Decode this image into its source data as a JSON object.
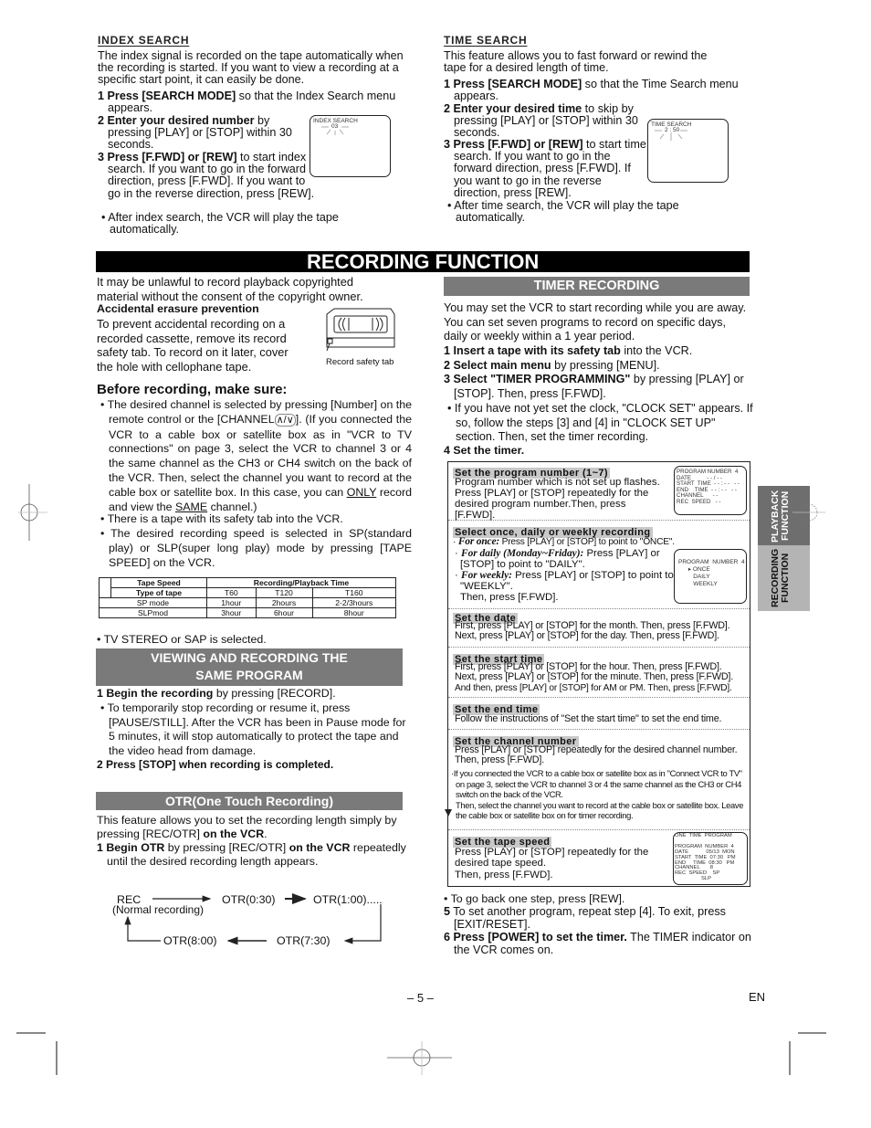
{
  "index_search": {
    "heading": "INDEX SEARCH",
    "intro": "The index signal is recorded on the tape automatically when the recording is started. If you want to view a recording at a specific start point, it can easily be done.",
    "steps": [
      {
        "num": "1",
        "bold": "Press [SEARCH MODE]",
        "text": " so that the Index Search menu appears."
      },
      {
        "num": "2",
        "bold": "Enter your desired number",
        "text": " by pressing [PLAY] or [STOP] within 30 seconds."
      },
      {
        "num": "3",
        "bold": "Press [F.FWD] or [REW]",
        "text": " to start index search. If you want to go in the forward direction, press [F.FWD]. If you want to go in the reverse direction, press [REW]."
      }
    ],
    "note": "After index search, the VCR will play the tape automatically.",
    "screen": {
      "title": "INDEX SEARCH",
      "value": "03"
    }
  },
  "time_search": {
    "heading": "TIME SEARCH",
    "intro": "This feature allows you to fast forward or rewind the tape for a desired length of time.",
    "steps": [
      {
        "num": "1",
        "bold": "Press  [SEARCH MODE]",
        "text": " so that the Time Search menu appears."
      },
      {
        "num": "2",
        "bold": "Enter your desired time",
        "text": " to skip by pressing [PLAY] or [STOP] within 30 seconds."
      },
      {
        "num": "3",
        "bold": "Press [F.FWD] or [REW]",
        "text": " to start time search. If you want to go in the forward direction, press [F.FWD]. If you want to go in the reverse direction, press [REW]."
      }
    ],
    "note": "After time search, the VCR will play the tape automatically.",
    "screen": {
      "title": "TIME SEARCH",
      "value": "2 : 50"
    }
  },
  "main_title": "RECORDING FUNCTION",
  "left": {
    "copyright": "It may be unlawful to record playback copyrighted material without the consent of the copyright owner.",
    "erasure_heading": "Accidental erasure prevention",
    "erasure_text": "To prevent accidental recording on a recorded cassette, remove its record safety tab. To record on it later, cover the hole with cellophane tape.",
    "cassette_caption": "Record safety tab",
    "before_heading": "Before recording, make sure:",
    "before_bullets": {
      "b1_a": "The desired channel is selected by pressing [Number] on the remote control or the [CHANNEL",
      "b1_sym": "∧/∨",
      "b1_b": "]. (If you connected the VCR to a cable box or satellite box as in \"VCR to TV connections\" on page 3, select the VCR to channel 3 or 4 the same channel as the CH3 or CH4 switch on the back of the VCR. Then, select the channel you want to record at the cable box or satellite box. In this case, you can ",
      "b1_u1": "ONLY",
      "b1_c": " record and view the ",
      "b1_u2": "SAME",
      "b1_d": " channel.)",
      "b2": "There is a tape with its safety tab into the VCR.",
      "b3": "The desired recording speed is selected in SP(standard play) or SLP(super long play) mode by pressing [TAPE SPEED] on the VCR."
    },
    "tape_table": {
      "h_speed": "Tape Speed",
      "h_time": "Recording/Playback Time",
      "h_type": "Type of tape",
      "cols": [
        "T60",
        "T120",
        "T160"
      ],
      "rows": [
        {
          "mode": "SP mode",
          "values": [
            "1hour",
            "2hours",
            "2-2/3hours"
          ]
        },
        {
          "mode": "SLPmod",
          "values": [
            "3hour",
            "6hour",
            "8hour"
          ]
        }
      ]
    },
    "stereo_note": "TV STEREO or SAP is selected.",
    "viewing": {
      "title_l1": "VIEWING AND RECORDING THE",
      "title_l2": "SAME PROGRAM",
      "step1_bold": "1 Begin the recording",
      "step1_text": " by pressing [RECORD].",
      "bullet": "To temporarily stop recording or resume it, press [PAUSE/STILL]. After the VCR has been in Pause mode for 5 minutes, it will stop automatically to protect the tape and the video head from damage.",
      "step2_bold": "2 Press [STOP] when recording is completed."
    },
    "otr": {
      "title": "OTR(One Touch Recording)",
      "intro_a": "This feature allows you to set the recording length simply by pressing [REC/OTR] ",
      "intro_b": "on the VCR",
      "intro_c": ".",
      "step1_bold": "1 Begin OTR",
      "step1_text": " by pressing [REC/OTR] ",
      "step1_bold2": "on the VCR",
      "step1_text2": " repeatedly until the desired recording length appears.",
      "diagram": {
        "rec": "REC",
        "rec_sub": "(Normal recording)",
        "n1": "OTR(0:30)",
        "n2": "OTR(1:00).....",
        "n3": "OTR(7:30)",
        "n4": "OTR(8:00)"
      }
    }
  },
  "timer": {
    "title": "TIMER RECORDING",
    "intro": "You may set the VCR to start recording while you are away. You can set seven programs to record on specific days, daily or weekly within a 1 year period.",
    "steps": [
      {
        "bold": "1 Insert a tape with its safety tab",
        "text": " into the VCR."
      },
      {
        "bold": "2 Select main menu",
        "text": " by pressing [MENU]."
      },
      {
        "bold": "3 Select \"TIMER PROGRAMMING\"",
        "text": " by pressing [PLAY] or [STOP]. Then, press [F.FWD]."
      }
    ],
    "clock_note": "If you have not yet set the clock, \"CLOCK SET\" appears. If so, follow the steps [3] and [4] in \"CLOCK SET UP\" section. Then, set the timer recording.",
    "step4": "4 Set the timer.",
    "sections": {
      "program": {
        "title": "Set the program number (1~7)",
        "text": "Program number which is not set up flashes. Press [PLAY] or [STOP] repeatedly for the desired program number.Then, press [F.FWD].",
        "screen": "PROGRAM NUMBER  4\nDATE          - - / - -\nSTART  TIME  - - : - -   - -\nEND    TIME  - - : - -   - -\nCHANNEL      - -\nREC  SPEED   - -"
      },
      "once": {
        "title": "Select once, daily or weekly recording",
        "once_label": "For once:",
        "once_text": " Press [PLAY] or [STOP] to point to \"ONCE\".",
        "daily_label": "For daily (Monday~Friday):",
        "daily_text": " Press [PLAY] or [STOP] to point to \"DAILY\".",
        "weekly_label": "For weekly:",
        "weekly_text": " Press [PLAY] or [STOP] to point to \"WEEKLY\".",
        "then": "Then, press [F.FWD].",
        "screen": "PROGRAM  NUMBER  4\n      ▸ ONCE\n         DAILY\n         WEEKLY"
      },
      "date": {
        "title": "Set the date",
        "text": "First, press [PLAY] or [STOP] for the month. Then, press [F.FWD]. Next, press [PLAY] or [STOP] for the day. Then, press [F.FWD]."
      },
      "start": {
        "title": "Set the start time",
        "l1": "First, press [PLAY] or [STOP] for the hour. Then, press [F.FWD].",
        "l2": "Next, press [PLAY] or [STOP] for the minute. Then, press [F.FWD].",
        "l3": "And then, press [PLAY] or [STOP] for AM or PM. Then, press [F.FWD]."
      },
      "end": {
        "title": "Set the end time",
        "text": "Follow the instructions of \"Set the start time\" to set the end time."
      },
      "channel": {
        "title": "Set the channel number",
        "text": "Press [PLAY] or [STOP] repeatedly for the desired channel number. Then, press [F.FWD].",
        "note1": "If you connected the VCR to a cable box or satellite box as in \"Connect VCR to TV\" on page 3, select the VCR to channel 3 or 4 the same channel as the CH3 or CH4 switch on the back of the VCR.",
        "note2": "Then, select the channel you want to record at the cable box or satellite box. Leave the cable box or satellite box on for timer recording."
      },
      "speed": {
        "title": "Set the tape speed",
        "text": "Press [PLAY] or [STOP] repeatedly for the desired tape speed.",
        "then": "Then, press [F.FWD].",
        "screen": "ONE  TIME  PROGRAM\n\nPROGRAM  NUMBER  4\nDATE            05/13  MON\nSTART  TIME  07:30   PM\nEND     TIME  08:30   PM\nCHANNEL       8\nREC  SPEED    SP\n                  SLP"
      }
    },
    "back_note": "To go back one step, press [REW].",
    "step5_num": "5",
    "step5_text": " To set another program, repeat step [4]. To exit, press [EXIT/RESET].",
    "step6_bold": "6 Press [POWER] to set the timer.",
    "step6_text": " The TIMER indicator on the VCR comes on."
  },
  "side_tabs": {
    "playback": "PLAYBACK FUNCTION",
    "recording": "RECORDING FUNCTION"
  },
  "footer": {
    "page": "– 5 –",
    "lang": "EN"
  }
}
